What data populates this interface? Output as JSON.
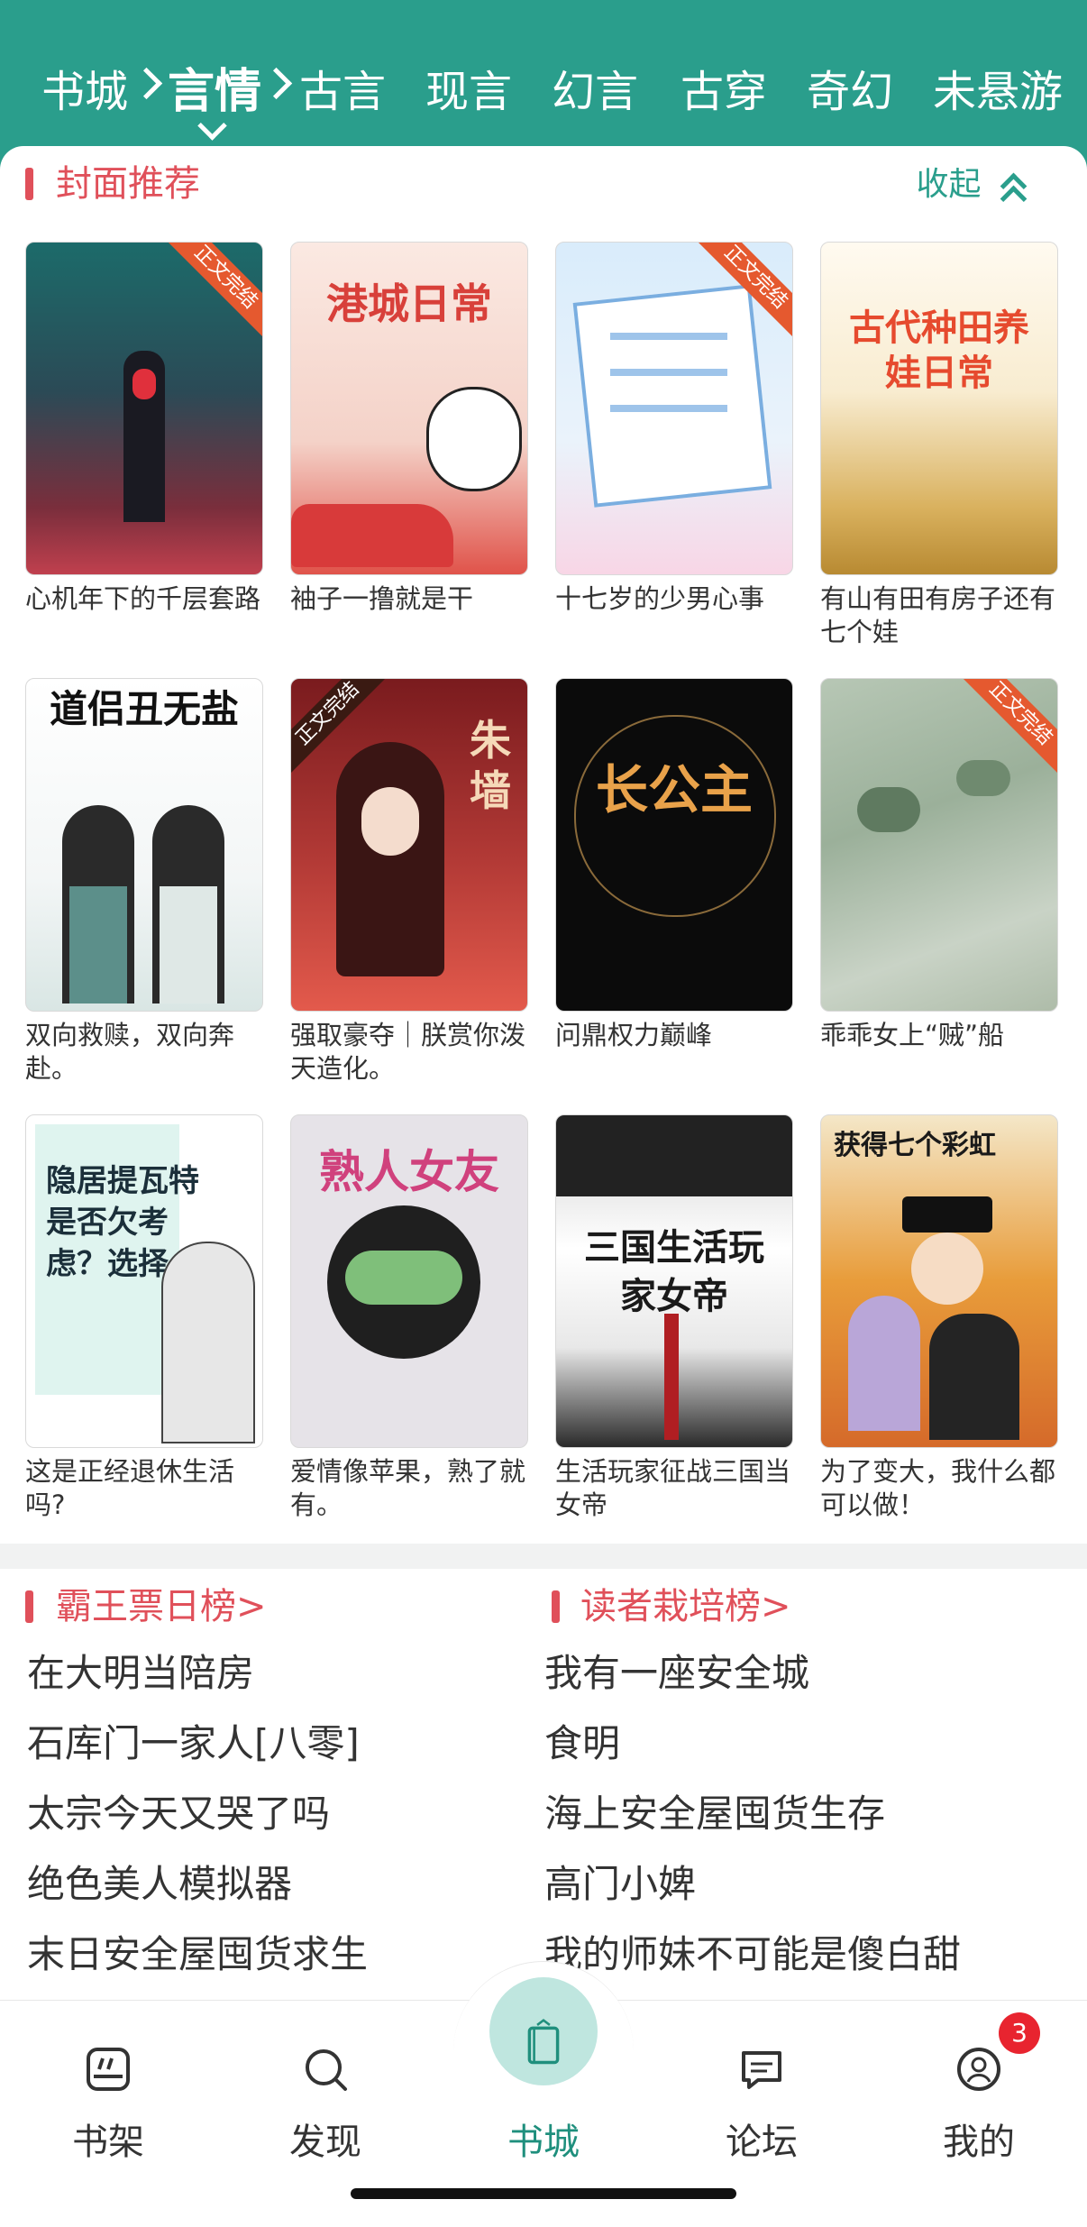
{
  "category_nav": {
    "items": [
      "书城",
      "言情",
      "古言",
      "现言",
      "幻言",
      "古穿",
      "奇幻",
      "未悬游"
    ],
    "active_index": 1
  },
  "cover_section": {
    "title": "封面推荐",
    "collapse_label": "收起",
    "cards": [
      {
        "title": "心机年下的千层套路",
        "cover_text": "",
        "badge": "正文完结"
      },
      {
        "title": "袖子一撸就是干",
        "cover_text": "港城日常",
        "badge": ""
      },
      {
        "title": "十七岁的少男心事",
        "cover_text": "",
        "badge": "正文完结"
      },
      {
        "title": "有山有田有房子还有七个娃",
        "cover_text": "古代种田养娃日常",
        "badge": ""
      },
      {
        "title": "双向救赎，双向奔赴。",
        "cover_text": "道侣丑无盐",
        "badge": ""
      },
      {
        "title": "强取豪夺｜朕赏你泼天造化。",
        "cover_text": "朱墙",
        "badge": "正文完结"
      },
      {
        "title": "问鼎权力巅峰",
        "cover_text": "长公主",
        "badge": ""
      },
      {
        "title": "乖乖女上“贼”船",
        "cover_text": "",
        "badge": "正文完结"
      },
      {
        "title": "这是正经退休生活吗?",
        "cover_text": "隐居提瓦特是否欠考虑？选择",
        "badge": ""
      },
      {
        "title": "爱情像苹果，熟了就有。",
        "cover_text": "熟人女友",
        "badge": ""
      },
      {
        "title": "生活玩家征战三国当女帝",
        "cover_text": "三国生活玩家女帝",
        "badge": ""
      },
      {
        "title": "为了变大，我什么都可以做！",
        "cover_text": "获得七个彩虹",
        "badge": ""
      }
    ]
  },
  "rankings": {
    "left": {
      "title": "霸王票日榜>",
      "items": [
        "在大明当陪房",
        "石库门一家人[八零]",
        "太宗今天又哭了吗",
        "绝色美人模拟器",
        "末日安全屋囤货求生"
      ]
    },
    "right": {
      "title": "读者栽培榜>",
      "items": [
        "我有一座安全城",
        "食明",
        "海上安全屋囤货生存",
        "高门小婢",
        "我的师妹不可能是傻白甜"
      ]
    }
  },
  "bottom_nav": {
    "items": [
      {
        "label": "书架",
        "icon": "bookshelf-icon"
      },
      {
        "label": "发现",
        "icon": "search-icon"
      },
      {
        "label": "书城",
        "icon": "book-icon"
      },
      {
        "label": "论坛",
        "icon": "chat-icon"
      },
      {
        "label": "我的",
        "icon": "user-icon"
      }
    ],
    "active_index": 2,
    "profile_badge": "3"
  },
  "colors": {
    "brand": "#2a9e8c",
    "accent_red": "#e0505a",
    "badge_red": "#e8242f"
  }
}
